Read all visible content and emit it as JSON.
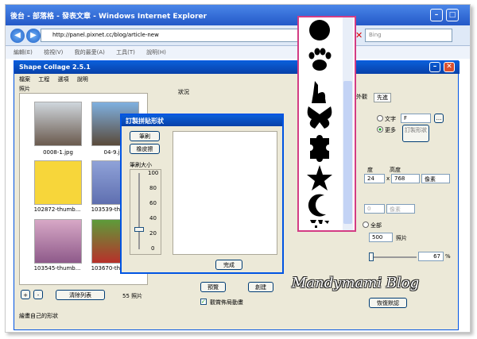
{
  "ie": {
    "title": "後台 - 部落格 - 發表文章 - Windows Internet Explorer",
    "url": "http://panel.pixnet.cc/blog/article-new",
    "search_placeholder": "Bing",
    "menu": [
      "編輯(E)",
      "檢視(V)",
      "我的最愛(A)",
      "工具(T)",
      "說明(H)"
    ]
  },
  "app": {
    "title": "Shape Collage 2.5.1",
    "menu": [
      "檔案",
      "工程",
      "選項",
      "說明"
    ],
    "photos_label": "照片",
    "status_label": "狀況",
    "photos": [
      {
        "name": "0008-1.jpg"
      },
      {
        "name": "04-9.jpg"
      },
      {
        "name": "102872-thumb..."
      },
      {
        "name": "103539-thumb..."
      },
      {
        "name": "103545-thumb..."
      },
      {
        "name": "103670-thumb..."
      }
    ],
    "clear_list": "清除列表",
    "photo_count": "55 照片",
    "preview_btn": "預覽",
    "create_btn": "創建",
    "animate_check": "觀賞佈局動畫",
    "status_bar": "繪畫自己的形狀",
    "tabs": [
      "外觀",
      "先進"
    ],
    "text_opt": "文字",
    "text_value": "F",
    "more_opt": "更多",
    "custom_btn": "訂製形狀",
    "height_label": "高度",
    "width_label": "度",
    "width_value": "24",
    "height_value": "768",
    "unit": "像素",
    "unit2": "像素",
    "all_label": "全部",
    "count_value": "500",
    "count_unit": "照片",
    "percent": "67",
    "restore_btn": "恢復默認"
  },
  "dialog": {
    "title": "訂製拼貼形狀",
    "brush_btn": "筆刷",
    "eraser_btn": "橡皮擦",
    "brush_size_label": "筆刷大小",
    "ticks": [
      "100",
      "80",
      "60",
      "40",
      "20",
      "0"
    ],
    "brush_value": 25,
    "done_btn": "完成"
  },
  "picker": {
    "shapes": [
      "circle-shape",
      "paw-shape",
      "cat-shape",
      "butterfly-shape",
      "puzzle-shape",
      "star-shape",
      "moon-shape",
      "world-map-shape"
    ]
  },
  "watermark": "Mandymami Blog"
}
